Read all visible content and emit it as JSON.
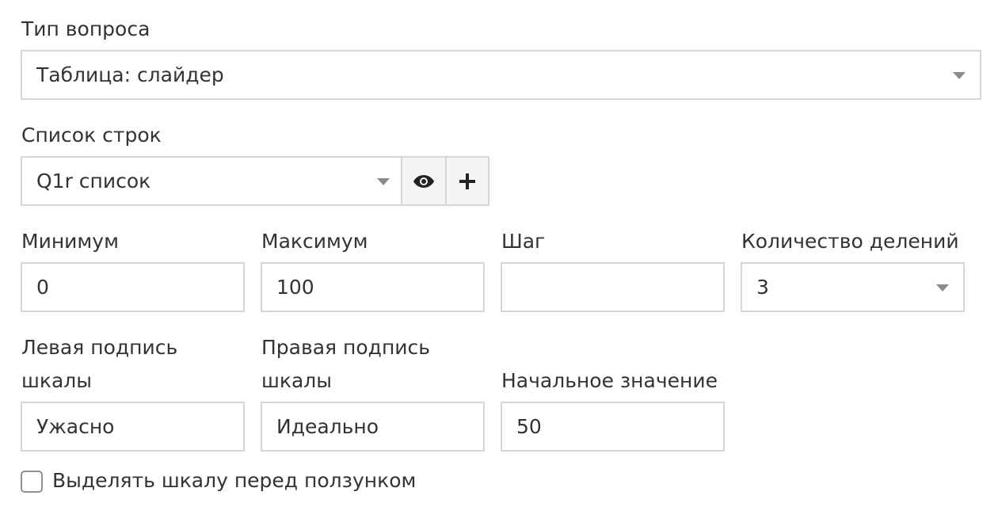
{
  "question_type": {
    "label": "Тип вопроса",
    "value": "Таблица: слайдер"
  },
  "row_list": {
    "label": "Список строк",
    "value": "Q1r список",
    "view_icon": "eye-icon",
    "add_icon": "plus-icon"
  },
  "minimum": {
    "label": "Минимум",
    "value": "0"
  },
  "maximum": {
    "label": "Максимум",
    "value": "100"
  },
  "step": {
    "label": "Шаг",
    "value": ""
  },
  "divisions": {
    "label": "Количество делений",
    "value": "3"
  },
  "left_caption": {
    "label": "Левая подпись шкалы",
    "value": "Ужасно"
  },
  "right_caption": {
    "label": "Правая подпись шкалы",
    "value": "Идеально"
  },
  "initial_value": {
    "label": "Начальное значение",
    "value": "50"
  },
  "highlight_checkbox": {
    "label": "Выделять шкалу перед ползунком",
    "checked": false
  },
  "colors": {
    "text": "#333333",
    "border": "#d6d6d6",
    "caret": "#8a8a8a",
    "addon_bg": "#f5f5f5"
  }
}
